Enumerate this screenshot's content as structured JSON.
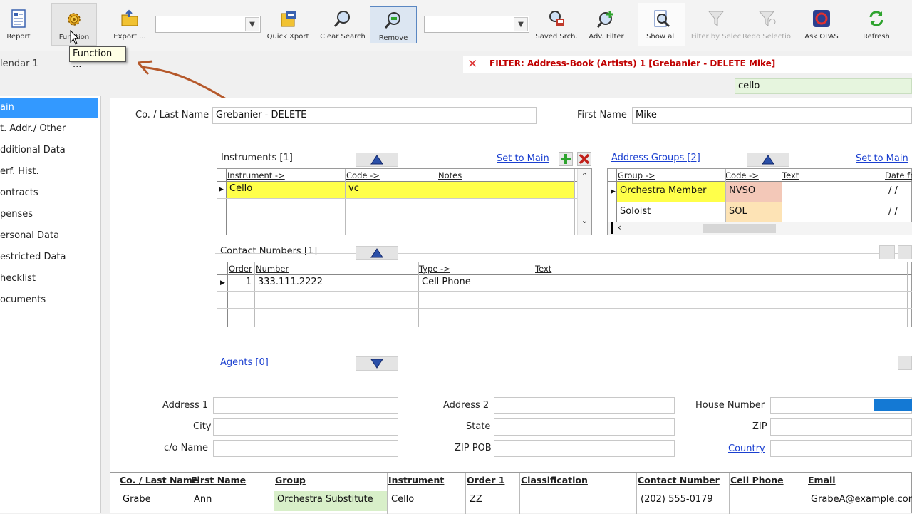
{
  "toolbar": {
    "report": "Report",
    "function": "Function",
    "export": "Export ...",
    "quick_xport": "Quick Xport",
    "clear_search": "Clear Search",
    "remove": "Remove",
    "saved_srch": "Saved Srch.",
    "adv_filter": "Adv. Filter",
    "show_all": "Show all",
    "filter_by_selec": "Filter by Selec",
    "redo_selectio": "Redo Selectio",
    "ask_opas": "Ask OPAS",
    "refresh": "Refresh"
  },
  "tooltip": "Function ...",
  "tab_title": "lendar 1",
  "filter": {
    "text": "FILTER: Address-Book (Artists)  1 [Grebanier - DELETE Mike]",
    "search_value": "cello"
  },
  "sidebar": {
    "items": [
      {
        "label": "ain",
        "selected": true
      },
      {
        "label": "t. Addr./ Other"
      },
      {
        "label": "dditional Data"
      },
      {
        "label": "erf. Hist."
      },
      {
        "label": "ontracts"
      },
      {
        "label": "penses"
      },
      {
        "label": "ersonal Data"
      },
      {
        "label": "estricted Data"
      },
      {
        "label": "hecklist"
      },
      {
        "label": "ocuments"
      }
    ]
  },
  "person": {
    "last_name_label": "Co. / Last Name",
    "last_name": "Grebanier - DELETE",
    "first_name_label": "First Name",
    "first_name": "Mike"
  },
  "instruments": {
    "title": "Instruments  [1]",
    "set_to_main": "Set to Main",
    "headers": [
      "Instrument ->",
      "Code ->",
      "Notes"
    ],
    "rows": [
      [
        "Cello",
        "vc",
        ""
      ]
    ]
  },
  "address_groups": {
    "title": "Address Groups  [2]",
    "set_to_main": "Set to Main",
    "headers": [
      "Group ->",
      "Code ->",
      "Text",
      "Date fr"
    ],
    "rows": [
      [
        "Orchestra Member",
        "NVSO",
        "",
        "/ /"
      ],
      [
        "Soloist",
        "SOL",
        "",
        "/ /"
      ]
    ]
  },
  "contacts": {
    "title": "Contact Numbers  [1]",
    "headers": [
      "Order",
      "Number",
      "Type ->",
      "Text"
    ],
    "rows": [
      [
        "1",
        "333.111.2222",
        "Cell Phone",
        ""
      ]
    ]
  },
  "agents": {
    "title": "Agents  [0]"
  },
  "address": {
    "address1_label": "Address 1",
    "address2_label": "Address 2",
    "house_number_label": "House Number",
    "city_label": "City",
    "state_label": "State",
    "zip_label": "ZIP",
    "co_name_label": "c/o Name",
    "zip_pob_label": "ZIP POB",
    "country_label": "Country"
  },
  "results": {
    "headers": [
      "Co. / Last Name",
      "First Name",
      "Group",
      "Instrument",
      "Order 1",
      "Classification",
      "Contact Number",
      "Cell Phone",
      "Email"
    ],
    "rows": [
      [
        "Grabe",
        "Ann",
        "Orchestra Substitute",
        "Cello",
        "ZZ",
        "",
        "(202) 555-0179",
        "",
        "GrabeA@example.com"
      ]
    ]
  },
  "colors": {
    "selection": "#3399ff",
    "highlight_yellow": "#ffff4a",
    "filter_red": "#c00000",
    "link_blue": "#1a3fd0",
    "code_red": "#f3c8b8",
    "code_orange": "#fde3b5",
    "group_green": "#d8efc9"
  }
}
